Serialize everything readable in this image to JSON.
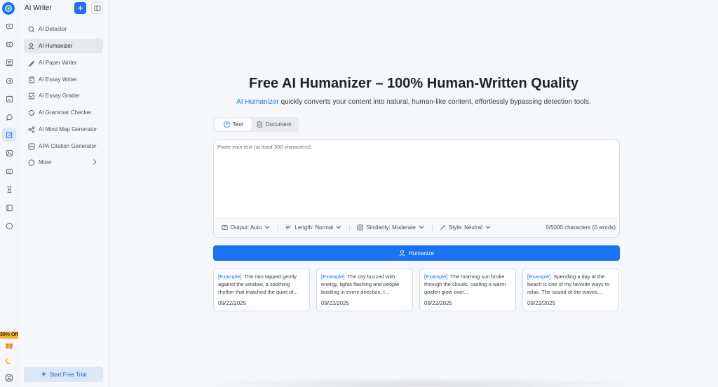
{
  "app": {
    "title": "AI Writer"
  },
  "rail": {
    "items": [
      "video-icon",
      "captions-icon",
      "list-icon",
      "arrow-in-icon",
      "image-edit-icon",
      "chat-icon",
      "pen-edit-icon",
      "image-icon",
      "bot-icon",
      "hourglass-icon",
      "book-icon",
      "circle-icon"
    ],
    "promo": "30% Off",
    "bottom": [
      "gift-icon",
      "moon-icon",
      "account-icon"
    ]
  },
  "sidebar": {
    "items": [
      {
        "label": "AI Detector",
        "icon": "detector-icon"
      },
      {
        "label": "AI Humanizer",
        "icon": "humanizer-icon",
        "active": true
      },
      {
        "label": "AI Paper Writer",
        "icon": "pen-icon"
      },
      {
        "label": "AI Essay Writer",
        "icon": "essay-icon"
      },
      {
        "label": "AI Essay Grader",
        "icon": "grader-icon"
      },
      {
        "label": "AI Grammar Checker",
        "icon": "grammar-icon"
      },
      {
        "label": "AI Mind Map Generator",
        "icon": "mindmap-icon"
      },
      {
        "label": "APA Citation Generator",
        "icon": "citation-icon"
      },
      {
        "label": "More",
        "icon": "more-icon"
      }
    ],
    "trial_label": "Start Free Trial"
  },
  "main": {
    "title": "Free AI Humanizer – 100% Human-Written Quality",
    "subtitle_link": "AI Humanizer",
    "subtitle_rest": " quickly converts your content into natural, human-like content, effortlessly bypassing detection tools.",
    "tabs": [
      {
        "label": "Text"
      },
      {
        "label": "Document"
      }
    ],
    "editor": {
      "placeholder": "Paste your text (at least 300 characters).",
      "value": ""
    },
    "options": {
      "output": "Output: Auto",
      "length": "Length: Normal",
      "similarity": "Similarity: Moderate",
      "style": "Style: Neutral",
      "count": "0/5000 characters (0 words)"
    },
    "humanize_label": "Humanize",
    "examples": [
      {
        "tag": "[Example]",
        "text": "The rain tapped gently against the window, a soothing rhythm that matched the quiet of...",
        "date": "09/22/2025"
      },
      {
        "tag": "[Example]",
        "text": "The city buzzed with energy, lights flashing and people bustling in every direction. I...",
        "date": "09/22/2025"
      },
      {
        "tag": "[Example]",
        "text": "The morning sun broke through the clouds, casting a warm golden glow over...",
        "date": "09/22/2025"
      },
      {
        "tag": "[Example]",
        "text": "Spending a day at the beach is one of my favorite ways to relax. The sound of the waves...",
        "date": "09/22/2025"
      }
    ]
  },
  "colors": {
    "accent": "#1a73f5",
    "promo": "#f3b32c"
  }
}
